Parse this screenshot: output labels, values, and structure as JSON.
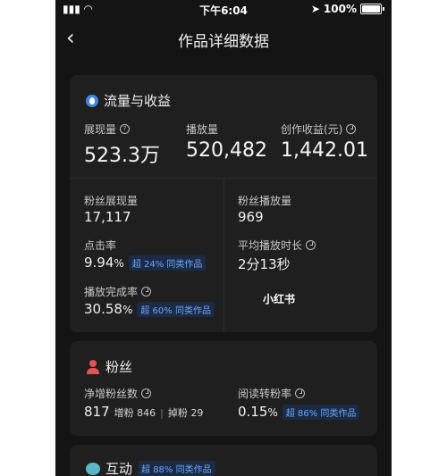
{
  "status_bar": {
    "time": "下午6:04",
    "battery": "100%"
  },
  "header": {
    "title": "作品详细数据"
  },
  "traffic": {
    "title": "流量与收益",
    "impressions_label": "展现量",
    "impressions_value": "523.3万",
    "plays_label": "播放量",
    "plays_value": "520,482",
    "earnings_label": "创作收益(元)",
    "earnings_value": "1,442.01",
    "fan_impressions_label": "粉丝展现量",
    "fan_impressions_value": "17,117",
    "fan_plays_label": "粉丝播放量",
    "fan_plays_value": "969",
    "ctr_label": "点击率",
    "ctr_value": "9.94",
    "ctr_unit": "%",
    "ctr_badge": "超 24% 同类作品",
    "avg_time_label": "平均播放时长",
    "avg_time_value": "2分13秒",
    "completion_label": "播放完成率",
    "completion_value": "30.58",
    "completion_unit": "%",
    "completion_badge": "超 60% 同类作品"
  },
  "fans": {
    "title": "粉丝",
    "net_label": "净增粉丝数",
    "net_value": "817",
    "gain_text": "增粉 846",
    "loss_text": "掉粉 29",
    "conversion_label": "阅读转粉率",
    "conversion_value": "0.15",
    "conversion_unit": "%",
    "conversion_badge": "超 86% 同类作品"
  },
  "interaction": {
    "title": "互动",
    "badge": "超 88% 同类作品"
  },
  "watermark": "小红书"
}
